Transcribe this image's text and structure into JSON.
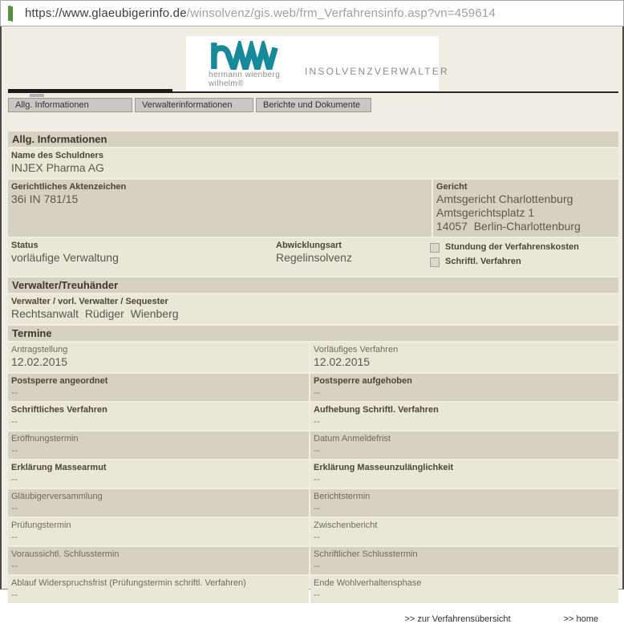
{
  "url_bar": {
    "secure_part": "https://www.glaeubigerinfo.de",
    "path_part": "/winsolvenz/gis.web/frm_Verfahrensinfo.asp?vn=459614"
  },
  "logo": {
    "wordmark": "hww",
    "subtitle": "hermann wienberg wilhelm®",
    "tagline": "INSOLVENZVERWALTER",
    "teal": "#16899b"
  },
  "tabs": [
    {
      "label": "Allg. Informationen"
    },
    {
      "label": "Verwalterinformationen"
    },
    {
      "label": "Berichte und Dokumente"
    }
  ],
  "sections": {
    "allg": {
      "title": "Allg. Informationen",
      "name_label": "Name des Schuldners",
      "name_value": "INJEX Pharma AG",
      "aktenzeichen_label": "Gerichtliches Aktenzeichen",
      "aktenzeichen_value": "36i IN 781/15",
      "gericht_label": "Gericht",
      "gericht_lines": [
        "Amtsgericht Charlottenburg",
        "Amtsgerichtsplatz 1",
        "14057  Berlin-Charlottenburg"
      ],
      "status_label": "Status",
      "status_value": "vorläufige Verwaltung",
      "abwicklungsart_label": "Abwicklungsart",
      "abwicklungsart_value": "Regelinsolvenz",
      "checkbox_stundung_label": "Stundung der Verfahrenskosten",
      "checkbox_schriftl_label": "Schriftl. Verfahren",
      "checkbox_stundung_checked": false,
      "checkbox_schriftl_checked": false
    },
    "verwalter": {
      "title": "Verwalter/Treuhänder",
      "label": "Verwalter / vorl. Verwalter / Sequester",
      "value": "Rechtsanwalt  Rüdiger  Wienberg"
    },
    "termine": {
      "title": "Termine",
      "rows": [
        {
          "left": {
            "label": "Antragstellung",
            "value": "12.02.2015"
          },
          "right": {
            "label": "Vorläufiges Verfahren",
            "value": "12.02.2015"
          }
        },
        {
          "left": {
            "label": "Postsperre angeordnet",
            "value": "--"
          },
          "right": {
            "label": "Postsperre aufgehoben",
            "value": "--"
          }
        },
        {
          "left": {
            "label": "Schriftliches Verfahren",
            "value": "--"
          },
          "right": {
            "label": "Aufhebung Schriftl. Verfahren",
            "value": "--"
          }
        },
        {
          "left": {
            "label": "Eröffnungstermin",
            "value": "--"
          },
          "right": {
            "label": "Datum Anmeldefrist",
            "value": "--"
          }
        },
        {
          "left": {
            "label": "Erklärung Massearmut",
            "value": "--"
          },
          "right": {
            "label": "Erklärung Masseunzulänglichkeit",
            "value": "--"
          }
        },
        {
          "left": {
            "label": "Gläubigerversammlung",
            "value": "--"
          },
          "right": {
            "label": "Berichtstermin",
            "value": "--"
          }
        },
        {
          "left": {
            "label": "Prüfungstermin",
            "value": "--"
          },
          "right": {
            "label": "Zwischenbericht",
            "value": "--"
          }
        },
        {
          "left": {
            "label": "Voraussichtl. Schlusstermin",
            "value": "--"
          },
          "right": {
            "label": "Schriftlicher Schlusstermin",
            "value": "--"
          }
        },
        {
          "left": {
            "label": "Ablauf Widerspruchsfrist (Prüfungstermin schriftl. Verfahren)",
            "value": "--"
          },
          "right": {
            "label": "Ende Wohlverhaltensphase",
            "value": "--"
          }
        }
      ]
    }
  },
  "footer": {
    "link_verfahrensuebersicht": ">> zur Verfahrensübersicht",
    "link_home": ">> home"
  }
}
